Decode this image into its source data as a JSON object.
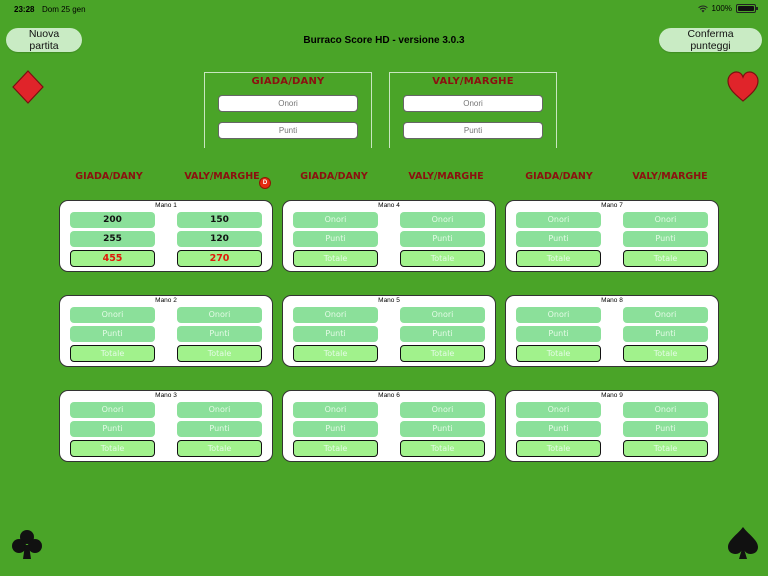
{
  "status": {
    "time": "23:28",
    "date": "Dom 25 gen",
    "battery": "100%"
  },
  "buttons": {
    "new_game": "Nuova partita",
    "confirm": "Conferma punteggi"
  },
  "app_title": "Burraco Score HD - versione 3.0.3",
  "icons": {
    "diamond": "diamond-icon",
    "heart": "heart-icon",
    "club": "club-icon",
    "spade": "spade-icon"
  },
  "colors": {
    "background": "#4aa428",
    "team_text": "#8b1010",
    "cell": "#8be09a",
    "total_cell": "#a1f28c",
    "total_text": "#e01a0a",
    "dealer": "#e52a10"
  },
  "entry": {
    "team_a": {
      "name": "GIADA/DANY",
      "onori_placeholder": "Onori",
      "punti_placeholder": "Punti"
    },
    "team_b": {
      "name": "VALY/MARGHE",
      "onori_placeholder": "Onori",
      "punti_placeholder": "Punti"
    }
  },
  "column_headers": [
    "GIADA/DANY",
    "VALY/MARGHE",
    "GIADA/DANY",
    "VALY/MARGHE",
    "GIADA/DANY",
    "VALY/MARGHE"
  ],
  "dealer_badge": "D",
  "hands": [
    {
      "title": "Mano 1",
      "a": {
        "onori": "200",
        "punti": "255",
        "totale": "455"
      },
      "b": {
        "onori": "150",
        "punti": "120",
        "totale": "270"
      }
    },
    {
      "title": "Mano 2",
      "a": {
        "onori": "Onori",
        "punti": "Punti",
        "totale": "Totale"
      },
      "b": {
        "onori": "Onori",
        "punti": "Punti",
        "totale": "Totale"
      }
    },
    {
      "title": "Mano 3",
      "a": {
        "onori": "Onori",
        "punti": "Punti",
        "totale": "Totale"
      },
      "b": {
        "onori": "Onori",
        "punti": "Punti",
        "totale": "Totale"
      }
    },
    {
      "title": "Mano 4",
      "a": {
        "onori": "Onori",
        "punti": "Punti",
        "totale": "Totale"
      },
      "b": {
        "onori": "Onori",
        "punti": "Punti",
        "totale": "Totale"
      }
    },
    {
      "title": "Mano 5",
      "a": {
        "onori": "Onori",
        "punti": "Punti",
        "totale": "Totale"
      },
      "b": {
        "onori": "Onori",
        "punti": "Punti",
        "totale": "Totale"
      }
    },
    {
      "title": "Mano 6",
      "a": {
        "onori": "Onori",
        "punti": "Punti",
        "totale": "Totale"
      },
      "b": {
        "onori": "Onori",
        "punti": "Punti",
        "totale": "Totale"
      }
    },
    {
      "title": "Mano 7",
      "a": {
        "onori": "Onori",
        "punti": "Punti",
        "totale": "Totale"
      },
      "b": {
        "onori": "Onori",
        "punti": "Punti",
        "totale": "Totale"
      }
    },
    {
      "title": "Mano 8",
      "a": {
        "onori": "Onori",
        "punti": "Punti",
        "totale": "Totale"
      },
      "b": {
        "onori": "Onori",
        "punti": "Punti",
        "totale": "Totale"
      }
    },
    {
      "title": "Mano 9",
      "a": {
        "onori": "Onori",
        "punti": "Punti",
        "totale": "Totale"
      },
      "b": {
        "onori": "Onori",
        "punti": "Punti",
        "totale": "Totale"
      }
    }
  ]
}
